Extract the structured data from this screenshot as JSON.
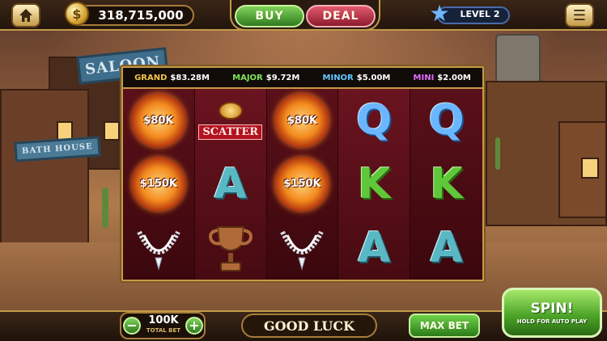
{
  "header": {
    "coins": "318,715,000",
    "buy_label": "BUY",
    "deal_label": "DEAL",
    "level_label": "LEVEL 2"
  },
  "jackpots": [
    {
      "name": "GRAND",
      "value": "$83.28M"
    },
    {
      "name": "MAJOR",
      "value": "$9.72M"
    },
    {
      "name": "MINOR",
      "value": "$5.00M"
    },
    {
      "name": "MINI",
      "value": "$2.00M"
    }
  ],
  "scenery": {
    "saloon_sign": "SALOON",
    "bath_sign": "BATH HOUSE"
  },
  "reels": [
    [
      {
        "symbol": "fireball",
        "text": "$80K"
      },
      {
        "symbol": "fireball",
        "text": "$150K"
      },
      {
        "symbol": "necklace",
        "text": ""
      }
    ],
    [
      {
        "symbol": "scatter",
        "text": "SCATTER"
      },
      {
        "symbol": "A",
        "text": "A"
      },
      {
        "symbol": "trophy",
        "text": ""
      }
    ],
    [
      {
        "symbol": "fireball",
        "text": "$80K"
      },
      {
        "symbol": "fireball",
        "text": "$150K"
      },
      {
        "symbol": "necklace",
        "text": ""
      }
    ],
    [
      {
        "symbol": "Q",
        "text": "Q"
      },
      {
        "symbol": "K",
        "text": "K"
      },
      {
        "symbol": "A",
        "text": "A"
      }
    ],
    [
      {
        "symbol": "Q",
        "text": "Q"
      },
      {
        "symbol": "K",
        "text": "K"
      },
      {
        "symbol": "A",
        "text": "A"
      }
    ]
  ],
  "footer": {
    "bet_value": "100K",
    "bet_label": "TOTAL BET",
    "minus_label": "−",
    "plus_label": "+",
    "message": "GOOD LUCK",
    "max_bet_label": "MAX BET",
    "spin_label": "SPIN!",
    "spin_sub": "HOLD FOR AUTO PLAY"
  },
  "icons": {
    "home": "home-icon",
    "coin": "coin-icon",
    "star": "star-icon",
    "menu": "menu-icon"
  },
  "colors": {
    "grand": "#f2c24b",
    "major": "#7ee35a",
    "minor": "#63c6ff",
    "mini": "#e36bff",
    "frame_gold": "#c49a48",
    "spin_green": "#4ea62a"
  }
}
